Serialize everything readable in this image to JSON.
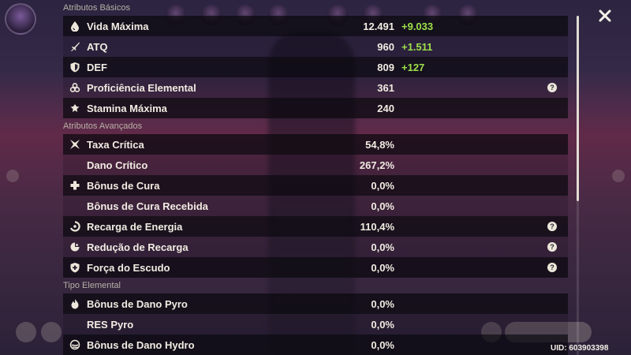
{
  "sections": {
    "basic": {
      "header": "Atributos Básicos",
      "rows": [
        {
          "icon": "droplet-icon",
          "label": "Vida Máxima",
          "value": "12.491",
          "bonus": "+9.033"
        },
        {
          "icon": "sword-icon",
          "label": "ATQ",
          "value": "960",
          "bonus": "+1.511"
        },
        {
          "icon": "shield-icon",
          "label": "DEF",
          "value": "809",
          "bonus": "+127"
        },
        {
          "icon": "triple-circle-icon",
          "label": "Proficiência Elemental",
          "value": "361",
          "bonus": ""
        },
        {
          "icon": "stamina-icon",
          "label": "Stamina Máxima",
          "value": "240",
          "bonus": ""
        }
      ]
    },
    "advanced": {
      "header": "Atributos Avançados",
      "rows": [
        {
          "icon": "crit-star-icon",
          "label": "Taxa Crítica",
          "value": "54,8%"
        },
        {
          "icon": "",
          "label": "Dano Crítico",
          "value": "267,2%"
        },
        {
          "icon": "plus-cross-icon",
          "label": "Bônus de Cura",
          "value": "0,0%"
        },
        {
          "icon": "",
          "label": "Bônus de Cura Recebida",
          "value": "0,0%"
        },
        {
          "icon": "energy-ring-icon",
          "label": "Recarga de Energia",
          "value": "110,4%"
        },
        {
          "icon": "cooldown-icon",
          "label": "Redução de Recarga",
          "value": "0,0%"
        },
        {
          "icon": "shield-plus-icon",
          "label": "Força do Escudo",
          "value": "0,0%"
        }
      ]
    },
    "elemental": {
      "header": "Tipo Elemental",
      "rows": [
        {
          "icon": "pyro-flame-icon",
          "label": "Bônus de Dano Pyro",
          "value": "0,0%"
        },
        {
          "icon": "",
          "label": "RES Pyro",
          "value": "0,0%"
        },
        {
          "icon": "hydro-wave-icon",
          "label": "Bônus de Dano Hydro",
          "value": "0,0%"
        }
      ]
    }
  },
  "help_glyph": "?",
  "close_label": "✕",
  "uid": "UID: 603903398",
  "colors": {
    "bonus_green": "#9ee04a",
    "text": "#f1ece2",
    "header": "#b7b1a5"
  }
}
